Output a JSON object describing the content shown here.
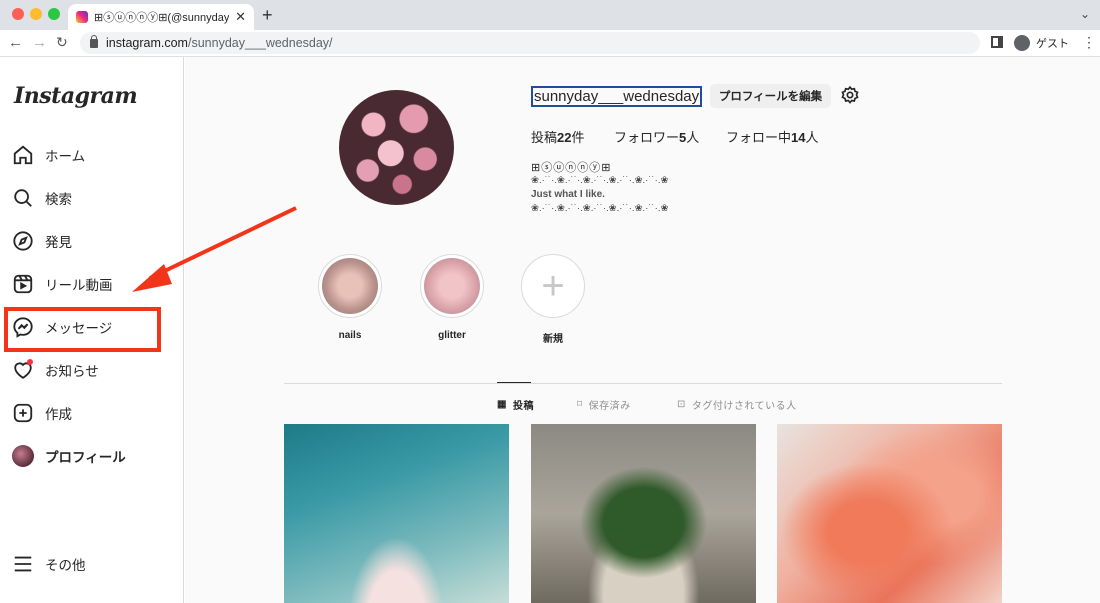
{
  "browser": {
    "tab_title": "⊞ⓢⓤⓝⓝⓨ⊞(@sunnyday___w",
    "url_host": "instagram.com",
    "url_path": "/sunnyday___wednesday/",
    "profile_label": "ゲスト"
  },
  "sidebar": {
    "logo": "Instagram",
    "items": [
      {
        "label": "ホーム",
        "icon": "home-icon"
      },
      {
        "label": "検索",
        "icon": "search-icon"
      },
      {
        "label": "発見",
        "icon": "compass-icon"
      },
      {
        "label": "リール動画",
        "icon": "reels-icon"
      },
      {
        "label": "メッセージ",
        "icon": "messenger-icon"
      },
      {
        "label": "お知らせ",
        "icon": "heart-icon"
      },
      {
        "label": "作成",
        "icon": "plus-square-icon"
      },
      {
        "label": "プロフィール",
        "icon": "avatar"
      }
    ],
    "more_label": "その他"
  },
  "profile": {
    "username": "sunnyday___wednesday",
    "edit_button": "プロフィールを編集",
    "posts_prefix": "投稿",
    "posts_count": "22",
    "posts_suffix": "件",
    "followers_prefix": "フォロワー",
    "followers_count": "5",
    "followers_suffix": "人",
    "following_prefix": "フォロー中",
    "following_count": "14",
    "following_suffix": "人",
    "full_name": "⊞ⓢⓤⓝⓝⓨ⊞",
    "bio_line1": "❀.·˙˙·.❀.·˙˙·.❀.·˙˙·.❀.·˙˙·.❀.·˙˙·.❀",
    "bio_line2": "Just what I like.",
    "bio_line3": "❀.·˙˙·.❀.·˙˙·.❀.·˙˙·.❀.·˙˙·.❀.·˙˙·.❀"
  },
  "highlights": [
    {
      "label": "nails"
    },
    {
      "label": "glitter"
    },
    {
      "label": "新規"
    }
  ],
  "profile_tabs": [
    {
      "label": "投稿",
      "icon": "grid-icon"
    },
    {
      "label": "保存済み",
      "icon": "bookmark-icon"
    },
    {
      "label": "タグ付けされている人",
      "icon": "tag-icon"
    }
  ],
  "colors": {
    "annotation_red": "#f2341b",
    "notification_dot": "#ff3040"
  }
}
